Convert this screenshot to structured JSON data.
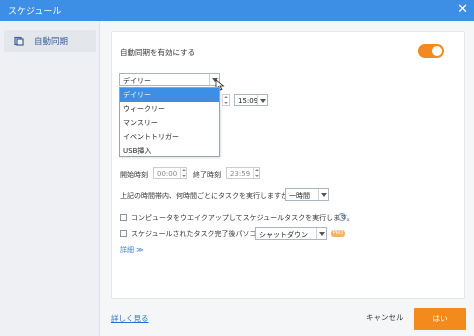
{
  "window": {
    "title": "スケジュール",
    "close_glyph": "✕"
  },
  "sidebar": {
    "items": [
      {
        "label": "自動同期",
        "icon": "folder-icon"
      }
    ]
  },
  "settings": {
    "auto_sync_label": "自動同期を有効にする",
    "auto_sync_enabled": true,
    "frequency": {
      "selected": "デイリー",
      "options": [
        "デイリー",
        "ウィークリー",
        "マンスリー",
        "イベントトリガー",
        "USB挿入"
      ]
    },
    "time": "15:09",
    "start_time_label": "開始時刻",
    "start_time": "00:00",
    "end_time_label": "終了時刻",
    "end_time": "23:59",
    "interval_label": "上記の時間帯内、何時間ごとにタスクを実行しますか？",
    "interval_value": "一時間",
    "wake_label": "コンピュータをウエイクアップしてスケジュールタスクを実行します。",
    "wake_checked": false,
    "help_glyph": "?",
    "shutdown_label": "スケジュールされたタスク完了後パソコン",
    "shutdown_checked": false,
    "shutdown_value": "シャットダウン",
    "badge_text": "PRO",
    "details_label": "詳細 ≫"
  },
  "footer": {
    "learn_more": "詳しく見る",
    "cancel": "キャンセル",
    "ok": "はい"
  },
  "colors": {
    "accent_blue": "#3d8ee5",
    "accent_orange": "#f28a1e"
  }
}
